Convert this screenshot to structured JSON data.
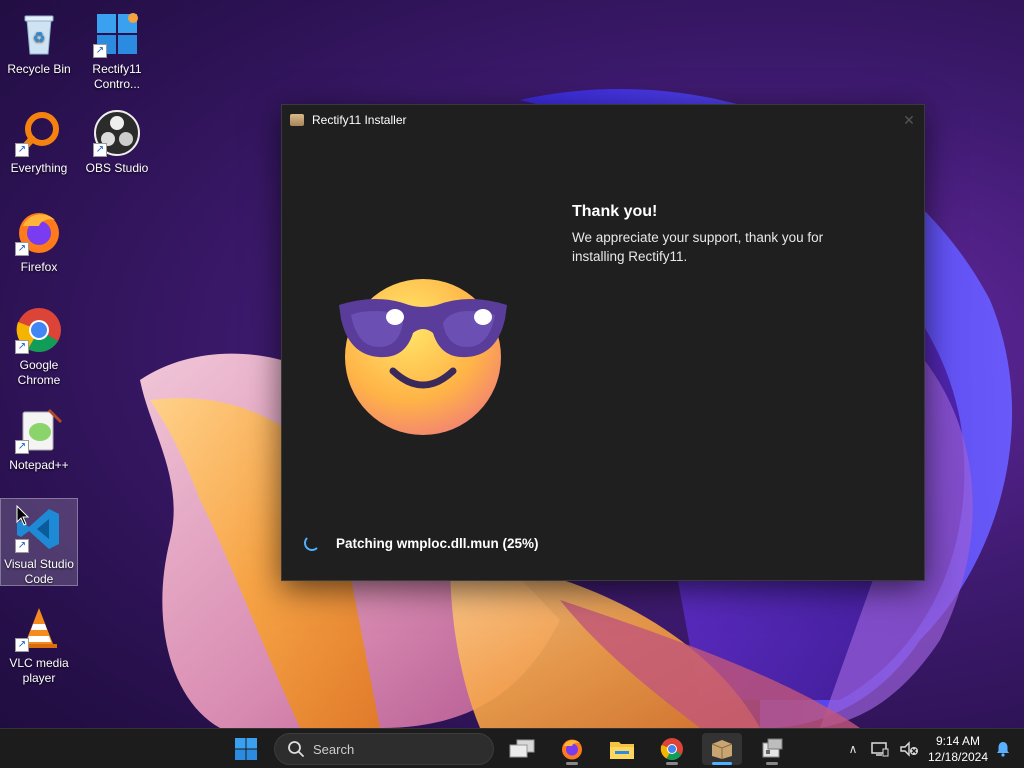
{
  "desktop": {
    "icons": [
      {
        "label": "Recycle Bin",
        "icon": "recycle-bin-icon"
      },
      {
        "label": "Rectify11 Contro...",
        "icon": "rectify11-control-panel-icon"
      },
      {
        "label": "Everything",
        "icon": "everything-search-icon"
      },
      {
        "label": "OBS Studio",
        "icon": "obs-studio-icon"
      },
      {
        "label": "Firefox",
        "icon": "firefox-icon"
      },
      {
        "label": "Google Chrome",
        "icon": "chrome-icon"
      },
      {
        "label": "Notepad++",
        "icon": "notepad-plus-plus-icon"
      },
      {
        "label": "Visual Studio Code",
        "icon": "vscode-icon"
      },
      {
        "label": "VLC media player",
        "icon": "vlc-icon"
      }
    ]
  },
  "installer": {
    "title": "Rectify11 Installer",
    "heading": "Thank you!",
    "message": "We appreciate your support, thank you for installing Rectify11.",
    "status": "Patching wmploc.dll.mun (25%)",
    "progress_percent": 25
  },
  "taskbar": {
    "search_placeholder": "Search",
    "apps": [
      "task-view-icon",
      "firefox-icon",
      "file-explorer-icon",
      "chrome-icon",
      "rectify11-installer-icon",
      "app-installer-icon"
    ],
    "clock_time": "9:14 AM",
    "clock_date": "12/18/2024"
  },
  "colors": {
    "accent": "#4fb0ff",
    "window_bg": "#1f1f1f",
    "taskbar_bg": "#1c1c1c"
  }
}
